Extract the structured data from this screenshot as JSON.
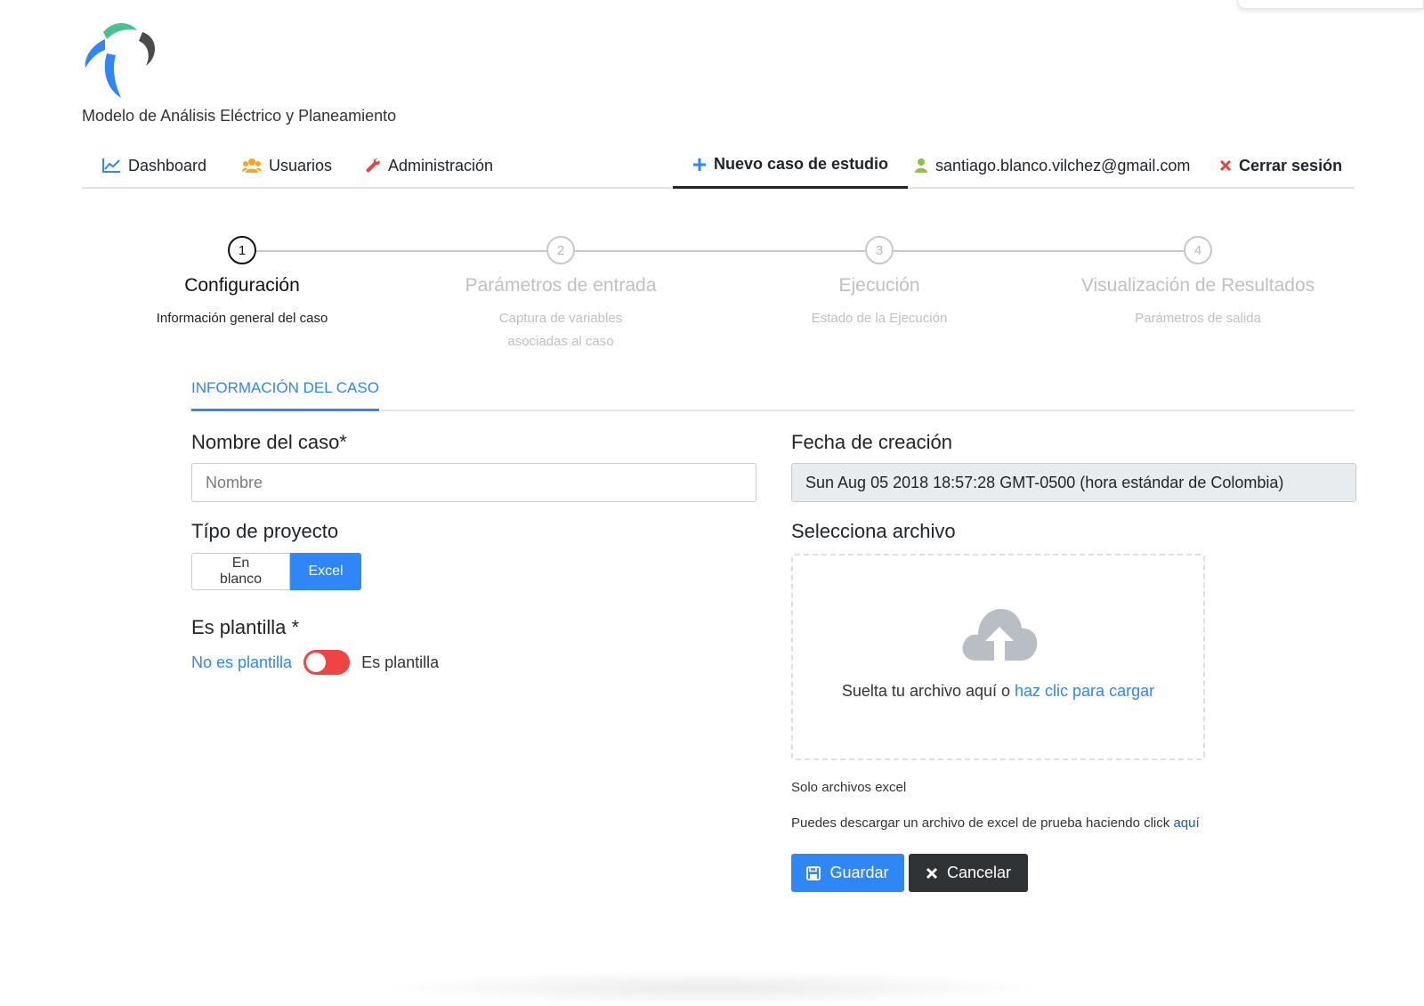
{
  "brand": {
    "name": "Modelo de Análisis Eléctrico y Planeamiento"
  },
  "nav": {
    "dashboard": "Dashboard",
    "usuarios": "Usuarios",
    "administracion": "Administración",
    "nuevo_caso": "Nuevo caso de estudio",
    "user_email": "santiago.blanco.vilchez@gmail.com",
    "cerrar_sesion": "Cerrar sesión"
  },
  "steps": [
    {
      "number": "1",
      "title": "Configuración",
      "desc": "Información general del caso"
    },
    {
      "number": "2",
      "title": "Parámetros de entrada",
      "desc": "Captura de variables asociadas al caso"
    },
    {
      "number": "3",
      "title": "Ejecución",
      "desc": "Estado de la Ejecución"
    },
    {
      "number": "4",
      "title": "Visualización de Resultados",
      "desc": "Parámetros de salida"
    }
  ],
  "section_tab": "INFORMACIÓN DEL CASO",
  "form": {
    "nombre_label": "Nombre del caso*",
    "nombre_placeholder": "Nombre",
    "nombre_value": "",
    "fecha_label": "Fecha de creación",
    "fecha_value": "Sun Aug 05 2018 18:57:28 GMT-0500 (hora estándar de Colombia)",
    "tipo_label": "Típo de proyecto",
    "tipo_options": [
      "En blanco",
      "Excel"
    ],
    "tipo_selected": "Excel",
    "plantilla_label": "Es plantilla *",
    "plantilla_off": "No es plantilla",
    "plantilla_on": "Es plantilla",
    "archivo_label": "Selecciona archivo",
    "dropzone_text": "Suelta tu archivo aquí o ",
    "dropzone_link": "haz clic para cargar",
    "help_only_excel": "Solo archivos excel",
    "help_download": "Puedes descargar un archivo de excel de prueba haciendo click ",
    "help_download_link": "aquí"
  },
  "buttons": {
    "guardar": "Guardar",
    "cancelar": "Cancelar"
  },
  "colors": {
    "primary": "#2f86f6",
    "dark": "#2f3336",
    "toggle": "#ef4444",
    "logo_green": "#4cbf95",
    "logo_blue": "#2f86f6",
    "logo_gray": "#4a4a4a"
  },
  "icons": {
    "dashboard": "chart-line-icon",
    "usuarios": "users-icon",
    "administracion": "wrench-icon",
    "nuevo_caso": "plus-icon",
    "user": "user-icon",
    "cerrar": "close-icon",
    "upload": "cloud-upload-icon",
    "guardar": "save-icon",
    "cancelar": "times-icon"
  }
}
